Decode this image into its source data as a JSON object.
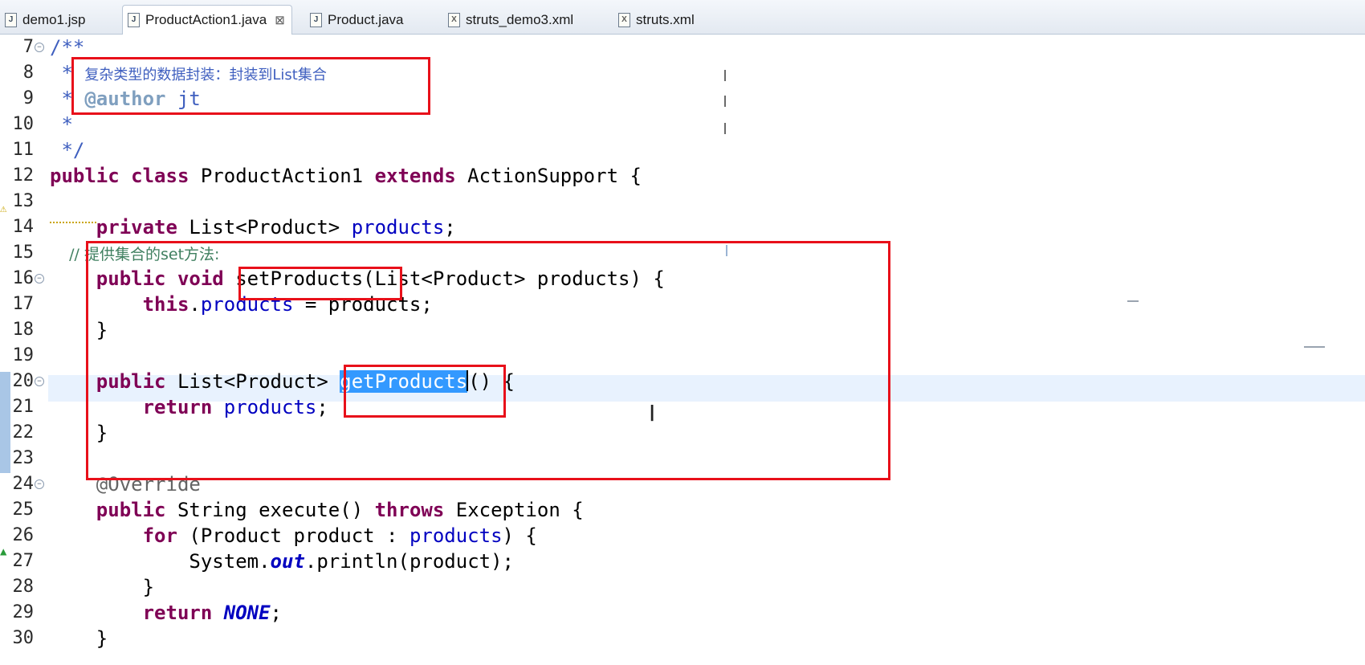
{
  "tabs": [
    {
      "label": "demo1.jsp",
      "icon": "jsp-file-icon",
      "active": false
    },
    {
      "label": "ProductAction1.java",
      "icon": "java-file-icon",
      "active": true
    },
    {
      "label": "Product.java",
      "icon": "java-file-icon",
      "active": false
    },
    {
      "label": "struts_demo3.xml",
      "icon": "xml-file-icon",
      "active": false
    },
    {
      "label": "struts.xml",
      "icon": "xml-file-icon",
      "active": false
    }
  ],
  "lines": [
    {
      "n": "7",
      "fold": true
    },
    {
      "n": "8"
    },
    {
      "n": "9"
    },
    {
      "n": "10"
    },
    {
      "n": "11"
    },
    {
      "n": "12"
    },
    {
      "n": "13"
    },
    {
      "n": "14"
    },
    {
      "n": "15"
    },
    {
      "n": "16",
      "fold": true
    },
    {
      "n": "17"
    },
    {
      "n": "18"
    },
    {
      "n": "19"
    },
    {
      "n": "20",
      "fold": true
    },
    {
      "n": "21"
    },
    {
      "n": "22"
    },
    {
      "n": "23"
    },
    {
      "n": "24",
      "fold": true
    },
    {
      "n": "25"
    },
    {
      "n": "26"
    },
    {
      "n": "27"
    },
    {
      "n": "28"
    },
    {
      "n": "29"
    },
    {
      "n": "30"
    }
  ],
  "code": {
    "l7": "/**",
    "l8_star": " * ",
    "l8_comment": "复杂类型的数据封装：封装到List集合",
    "l9_star": " * ",
    "l9_tag": "@author",
    "l9_rest": " jt",
    "l10": " *",
    "l11": " */",
    "l12_kw": "public class",
    "l12_name": " ProductAction1 ",
    "l12_kw2": "extends",
    "l12_rest": " ActionSupport {",
    "l14_kw": "    private",
    "l14_type": " List<Product> ",
    "l14_field": "products",
    "l14_end": ";",
    "l15": "    // 提供集合的set方法:",
    "l16_kw": "    public void",
    "l16_rest": " setProducts(List<Product> products) {",
    "l17_kw": "        this",
    "l17_dot": ".",
    "l17_field": "products",
    "l17_rest": " = products;",
    "l18": "    }",
    "l20_kw": "    public",
    "l20_type": " List<Product> ",
    "l20_sel": "getProducts",
    "l20_rest": "() {",
    "l21_kw": "        return",
    "l21_field": " products",
    "l21_rest": ";",
    "l22": "    }",
    "l24": "    @Override",
    "l25_kw": "    public",
    "l25_mid": " String execute() ",
    "l25_kw2": "throws",
    "l25_rest": " Exception {",
    "l26_kw": "        for",
    "l26_mid": " (Product product : ",
    "l26_field": "products",
    "l26_rest": ") {",
    "l27_pre": "            System.",
    "l27_out": "out",
    "l27_rest": ".println(product);",
    "l28": "        }",
    "l29_kw": "        return",
    "l29_sp": " ",
    "l29_const": "NONE",
    "l29_end": ";",
    "l30": "    }"
  }
}
